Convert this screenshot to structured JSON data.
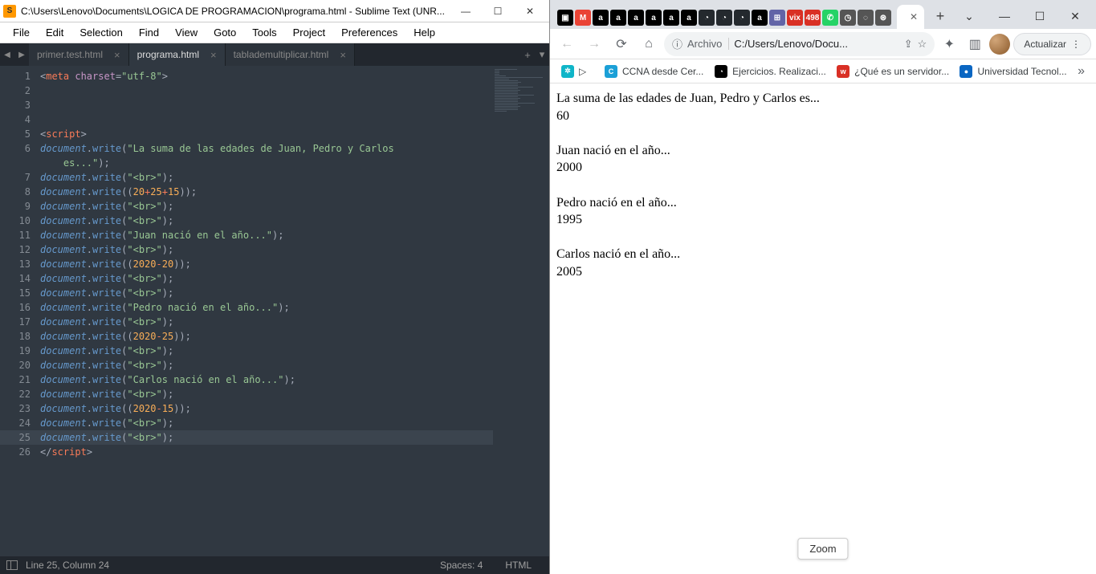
{
  "sublime": {
    "title": "C:\\Users\\Lenovo\\Documents\\LOGICA DE PROGRAMACION\\programa.html - Sublime Text (UNR...",
    "menus": [
      "File",
      "Edit",
      "Selection",
      "Find",
      "View",
      "Goto",
      "Tools",
      "Project",
      "Preferences",
      "Help"
    ],
    "tabs": [
      {
        "name": "primer.test.html",
        "active": false
      },
      {
        "name": "programa.html",
        "active": true
      },
      {
        "name": "tablademultiplicar.html",
        "active": false
      }
    ],
    "active_line": 25,
    "code": [
      {
        "n": 1,
        "segs": [
          {
            "c": "tk-punc",
            "t": "<"
          },
          {
            "c": "tk-tag",
            "t": "meta "
          },
          {
            "c": "tk-attr",
            "t": "charset"
          },
          {
            "c": "tk-punc",
            "t": "="
          },
          {
            "c": "tk-str",
            "t": "\"utf-8\""
          },
          {
            "c": "tk-punc",
            "t": ">"
          }
        ]
      },
      {
        "n": 2,
        "segs": []
      },
      {
        "n": 3,
        "segs": []
      },
      {
        "n": 4,
        "segs": []
      },
      {
        "n": 5,
        "segs": [
          {
            "c": "tk-punc",
            "t": "<"
          },
          {
            "c": "tk-tag",
            "t": "script"
          },
          {
            "c": "tk-punc",
            "t": ">"
          }
        ]
      },
      {
        "n": 6,
        "segs": [
          {
            "c": "tk-obj",
            "t": "document"
          },
          {
            "c": "tk-dot",
            "t": "."
          },
          {
            "c": "tk-meth",
            "t": "write"
          },
          {
            "c": "tk-punc",
            "t": "("
          },
          {
            "c": "tk-str",
            "t": "\"La suma de las edades de Juan, Pedro y Carlos "
          }
        ]
      },
      {
        "n": 0,
        "cont": true,
        "segs": [
          {
            "c": "",
            "t": "    "
          },
          {
            "c": "tk-str",
            "t": "es...\""
          },
          {
            "c": "tk-punc",
            "t": ");"
          }
        ]
      },
      {
        "n": 7,
        "segs": [
          {
            "c": "tk-obj",
            "t": "document"
          },
          {
            "c": "tk-dot",
            "t": "."
          },
          {
            "c": "tk-meth",
            "t": "write"
          },
          {
            "c": "tk-punc",
            "t": "("
          },
          {
            "c": "tk-str",
            "t": "\"<br>\""
          },
          {
            "c": "tk-punc",
            "t": ");"
          }
        ]
      },
      {
        "n": 8,
        "segs": [
          {
            "c": "tk-obj",
            "t": "document"
          },
          {
            "c": "tk-dot",
            "t": "."
          },
          {
            "c": "tk-meth",
            "t": "write"
          },
          {
            "c": "tk-punc",
            "t": "(("
          },
          {
            "c": "tk-num",
            "t": "20"
          },
          {
            "c": "tk-op",
            "t": "+"
          },
          {
            "c": "tk-num",
            "t": "25"
          },
          {
            "c": "tk-op",
            "t": "+"
          },
          {
            "c": "tk-num",
            "t": "15"
          },
          {
            "c": "tk-punc",
            "t": "));"
          }
        ]
      },
      {
        "n": 9,
        "segs": [
          {
            "c": "tk-obj",
            "t": "document"
          },
          {
            "c": "tk-dot",
            "t": "."
          },
          {
            "c": "tk-meth",
            "t": "write"
          },
          {
            "c": "tk-punc",
            "t": "("
          },
          {
            "c": "tk-str",
            "t": "\"<br>\""
          },
          {
            "c": "tk-punc",
            "t": ");"
          }
        ]
      },
      {
        "n": 10,
        "segs": [
          {
            "c": "tk-obj",
            "t": "document"
          },
          {
            "c": "tk-dot",
            "t": "."
          },
          {
            "c": "tk-meth",
            "t": "write"
          },
          {
            "c": "tk-punc",
            "t": "("
          },
          {
            "c": "tk-str",
            "t": "\"<br>\""
          },
          {
            "c": "tk-punc",
            "t": ");"
          }
        ]
      },
      {
        "n": 11,
        "segs": [
          {
            "c": "tk-obj",
            "t": "document"
          },
          {
            "c": "tk-dot",
            "t": "."
          },
          {
            "c": "tk-meth",
            "t": "write"
          },
          {
            "c": "tk-punc",
            "t": "("
          },
          {
            "c": "tk-str",
            "t": "\"Juan nació en el año...\""
          },
          {
            "c": "tk-punc",
            "t": ");"
          }
        ]
      },
      {
        "n": 12,
        "segs": [
          {
            "c": "tk-obj",
            "t": "document"
          },
          {
            "c": "tk-dot",
            "t": "."
          },
          {
            "c": "tk-meth",
            "t": "write"
          },
          {
            "c": "tk-punc",
            "t": "("
          },
          {
            "c": "tk-str",
            "t": "\"<br>\""
          },
          {
            "c": "tk-punc",
            "t": ");"
          }
        ]
      },
      {
        "n": 13,
        "segs": [
          {
            "c": "tk-obj",
            "t": "document"
          },
          {
            "c": "tk-dot",
            "t": "."
          },
          {
            "c": "tk-meth",
            "t": "write"
          },
          {
            "c": "tk-punc",
            "t": "(("
          },
          {
            "c": "tk-num",
            "t": "2020"
          },
          {
            "c": "tk-op",
            "t": "-"
          },
          {
            "c": "tk-num",
            "t": "20"
          },
          {
            "c": "tk-punc",
            "t": "));"
          }
        ]
      },
      {
        "n": 14,
        "segs": [
          {
            "c": "tk-obj",
            "t": "document"
          },
          {
            "c": "tk-dot",
            "t": "."
          },
          {
            "c": "tk-meth",
            "t": "write"
          },
          {
            "c": "tk-punc",
            "t": "("
          },
          {
            "c": "tk-str",
            "t": "\"<br>\""
          },
          {
            "c": "tk-punc",
            "t": ");"
          }
        ]
      },
      {
        "n": 15,
        "segs": [
          {
            "c": "tk-obj",
            "t": "document"
          },
          {
            "c": "tk-dot",
            "t": "."
          },
          {
            "c": "tk-meth",
            "t": "write"
          },
          {
            "c": "tk-punc",
            "t": "("
          },
          {
            "c": "tk-str",
            "t": "\"<br>\""
          },
          {
            "c": "tk-punc",
            "t": ");"
          }
        ]
      },
      {
        "n": 16,
        "segs": [
          {
            "c": "tk-obj",
            "t": "document"
          },
          {
            "c": "tk-dot",
            "t": "."
          },
          {
            "c": "tk-meth",
            "t": "write"
          },
          {
            "c": "tk-punc",
            "t": "("
          },
          {
            "c": "tk-str",
            "t": "\"Pedro nació en el año...\""
          },
          {
            "c": "tk-punc",
            "t": ");"
          }
        ]
      },
      {
        "n": 17,
        "segs": [
          {
            "c": "tk-obj",
            "t": "document"
          },
          {
            "c": "tk-dot",
            "t": "."
          },
          {
            "c": "tk-meth",
            "t": "write"
          },
          {
            "c": "tk-punc",
            "t": "("
          },
          {
            "c": "tk-str",
            "t": "\"<br>\""
          },
          {
            "c": "tk-punc",
            "t": ");"
          }
        ]
      },
      {
        "n": 18,
        "segs": [
          {
            "c": "tk-obj",
            "t": "document"
          },
          {
            "c": "tk-dot",
            "t": "."
          },
          {
            "c": "tk-meth",
            "t": "write"
          },
          {
            "c": "tk-punc",
            "t": "(("
          },
          {
            "c": "tk-num",
            "t": "2020"
          },
          {
            "c": "tk-op",
            "t": "-"
          },
          {
            "c": "tk-num",
            "t": "25"
          },
          {
            "c": "tk-punc",
            "t": "));"
          }
        ]
      },
      {
        "n": 19,
        "segs": [
          {
            "c": "tk-obj",
            "t": "document"
          },
          {
            "c": "tk-dot",
            "t": "."
          },
          {
            "c": "tk-meth",
            "t": "write"
          },
          {
            "c": "tk-punc",
            "t": "("
          },
          {
            "c": "tk-str",
            "t": "\"<br>\""
          },
          {
            "c": "tk-punc",
            "t": ");"
          }
        ]
      },
      {
        "n": 20,
        "segs": [
          {
            "c": "tk-obj",
            "t": "document"
          },
          {
            "c": "tk-dot",
            "t": "."
          },
          {
            "c": "tk-meth",
            "t": "write"
          },
          {
            "c": "tk-punc",
            "t": "("
          },
          {
            "c": "tk-str",
            "t": "\"<br>\""
          },
          {
            "c": "tk-punc",
            "t": ");"
          }
        ]
      },
      {
        "n": 21,
        "segs": [
          {
            "c": "tk-obj",
            "t": "document"
          },
          {
            "c": "tk-dot",
            "t": "."
          },
          {
            "c": "tk-meth",
            "t": "write"
          },
          {
            "c": "tk-punc",
            "t": "("
          },
          {
            "c": "tk-str",
            "t": "\"Carlos nació en el año...\""
          },
          {
            "c": "tk-punc",
            "t": ");"
          }
        ]
      },
      {
        "n": 22,
        "segs": [
          {
            "c": "tk-obj",
            "t": "document"
          },
          {
            "c": "tk-dot",
            "t": "."
          },
          {
            "c": "tk-meth",
            "t": "write"
          },
          {
            "c": "tk-punc",
            "t": "("
          },
          {
            "c": "tk-str",
            "t": "\"<br>\""
          },
          {
            "c": "tk-punc",
            "t": ");"
          }
        ]
      },
      {
        "n": 23,
        "segs": [
          {
            "c": "tk-obj",
            "t": "document"
          },
          {
            "c": "tk-dot",
            "t": "."
          },
          {
            "c": "tk-meth",
            "t": "write"
          },
          {
            "c": "tk-punc",
            "t": "(("
          },
          {
            "c": "tk-num",
            "t": "2020"
          },
          {
            "c": "tk-op",
            "t": "-"
          },
          {
            "c": "tk-num",
            "t": "15"
          },
          {
            "c": "tk-punc",
            "t": "));"
          }
        ]
      },
      {
        "n": 24,
        "segs": [
          {
            "c": "tk-obj",
            "t": "document"
          },
          {
            "c": "tk-dot",
            "t": "."
          },
          {
            "c": "tk-meth",
            "t": "write"
          },
          {
            "c": "tk-punc",
            "t": "("
          },
          {
            "c": "tk-str",
            "t": "\"<br>\""
          },
          {
            "c": "tk-punc",
            "t": ");"
          }
        ]
      },
      {
        "n": 25,
        "segs": [
          {
            "c": "tk-obj",
            "t": "document"
          },
          {
            "c": "tk-dot",
            "t": "."
          },
          {
            "c": "tk-meth",
            "t": "write"
          },
          {
            "c": "tk-punc",
            "t": "("
          },
          {
            "c": "tk-str",
            "t": "\"<br>\""
          },
          {
            "c": "tk-punc",
            "t": ");"
          }
        ]
      },
      {
        "n": 26,
        "segs": [
          {
            "c": "tk-punc",
            "t": "</"
          },
          {
            "c": "tk-close",
            "t": "script"
          },
          {
            "c": "tk-punc",
            "t": ">"
          }
        ]
      }
    ],
    "status": {
      "pos": "Line 25, Column 24",
      "spaces": "Spaces: 4",
      "lang": "HTML"
    }
  },
  "chrome": {
    "tab_icons": [
      {
        "bg": "#000",
        "t": "▣"
      },
      {
        "bg": "#ea4335",
        "t": "M"
      },
      {
        "bg": "#000",
        "t": "a"
      },
      {
        "bg": "#000",
        "t": "a"
      },
      {
        "bg": "#000",
        "t": "a"
      },
      {
        "bg": "#000",
        "t": "a"
      },
      {
        "bg": "#000",
        "t": "a"
      },
      {
        "bg": "#000",
        "t": "a"
      },
      {
        "bg": "#24292e",
        "t": "◔"
      },
      {
        "bg": "#24292e",
        "t": "◔"
      },
      {
        "bg": "#24292e",
        "t": "◔"
      },
      {
        "bg": "#000",
        "t": "a"
      },
      {
        "bg": "#6264a7",
        "t": "⊞"
      },
      {
        "bg": "#d93025",
        "t": "vix"
      },
      {
        "bg": "#d93025",
        "t": "498"
      },
      {
        "bg": "#25d366",
        "t": "✆"
      },
      {
        "bg": "#555",
        "t": "◷"
      },
      {
        "bg": "#555",
        "t": "◌"
      },
      {
        "bg": "#555",
        "t": "⊛"
      }
    ],
    "active_tab": "",
    "omnibox": {
      "scheme": "Archivo",
      "path": "C:/Users/Lenovo/Docu..."
    },
    "update_label": "Actualizar",
    "bookmarks": [
      {
        "bg": "#0fb5c8",
        "t": "✲",
        "label": "",
        "extra": "▷"
      },
      {
        "bg": "#1ba0d7",
        "t": "C",
        "label": "CCNA desde Cer..."
      },
      {
        "bg": "#000",
        "t": "◔",
        "label": "Ejercicios. Realizaci..."
      },
      {
        "bg": "#d93025",
        "t": "w",
        "label": "¿Qué es un servidor..."
      },
      {
        "bg": "#0a66c2",
        "t": "●",
        "label": "Universidad Tecnol..."
      }
    ],
    "page_lines": [
      "La suma de las edades de Juan, Pedro y Carlos es...",
      "60",
      "",
      "Juan nació en el año...",
      "2000",
      "",
      "Pedro nació en el año...",
      "1995",
      "",
      "Carlos nació en el año...",
      "2005"
    ],
    "zoom_label": "Zoom"
  }
}
